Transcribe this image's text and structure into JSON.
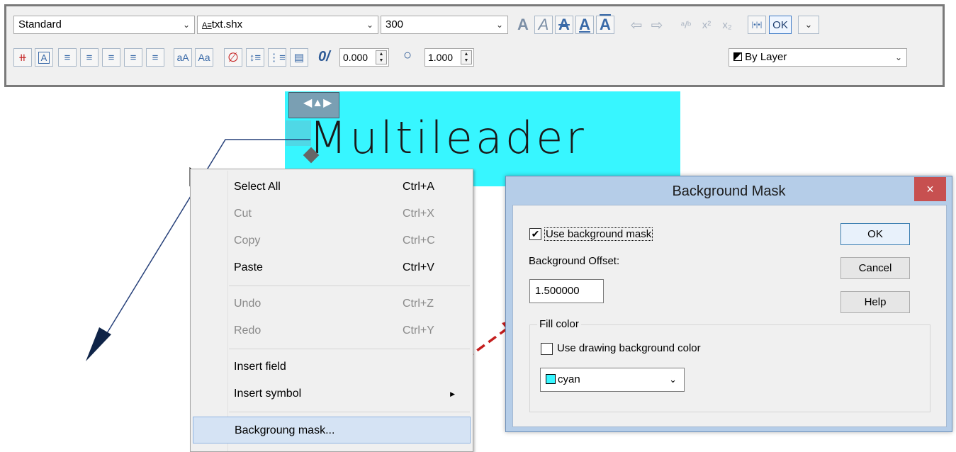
{
  "toolbar": {
    "style_value": "Standard",
    "font_value": "txt.shx",
    "height_value": "300",
    "bold_label": "A",
    "italic_label": "A",
    "strike_label": "A",
    "underline_label": "A",
    "overline_label": "A",
    "ok_label": "OK",
    "oblique_label": "0/",
    "oblique_value": "0.000",
    "tracking_value": "1.000",
    "color_value": "By Layer",
    "case_upper_label": "aA",
    "case_lower_label": "Aa"
  },
  "canvas": {
    "mtext": "Multileader",
    "mask_color": "#37f6ff"
  },
  "context_menu": {
    "items": [
      {
        "label": "Select All",
        "shortcut": "Ctrl+A",
        "enabled": true
      },
      {
        "label": "Cut",
        "shortcut": "Ctrl+X",
        "enabled": false
      },
      {
        "label": "Copy",
        "shortcut": "Ctrl+C",
        "enabled": false
      },
      {
        "label": "Paste",
        "shortcut": "Ctrl+V",
        "enabled": true
      },
      {
        "label": "Undo",
        "shortcut": "Ctrl+Z",
        "enabled": false
      },
      {
        "label": "Redo",
        "shortcut": "Ctrl+Y",
        "enabled": false
      },
      {
        "label": "Insert field",
        "shortcut": "",
        "enabled": true
      },
      {
        "label": "Insert symbol",
        "shortcut": "",
        "enabled": true
      },
      {
        "label": "Backgroung mask...",
        "shortcut": "",
        "enabled": true
      }
    ]
  },
  "dialog": {
    "title": "Background Mask",
    "use_mask_label": "Use background mask",
    "use_mask_checked": true,
    "offset_label": "Background Offset:",
    "offset_value": "1.500000",
    "fill_group_label": "Fill color",
    "use_drawing_bg_label": "Use drawing background color",
    "use_drawing_bg_checked": false,
    "color_value": "cyan",
    "ok_label": "OK",
    "cancel_label": "Cancel",
    "help_label": "Help",
    "close_glyph": "×"
  }
}
